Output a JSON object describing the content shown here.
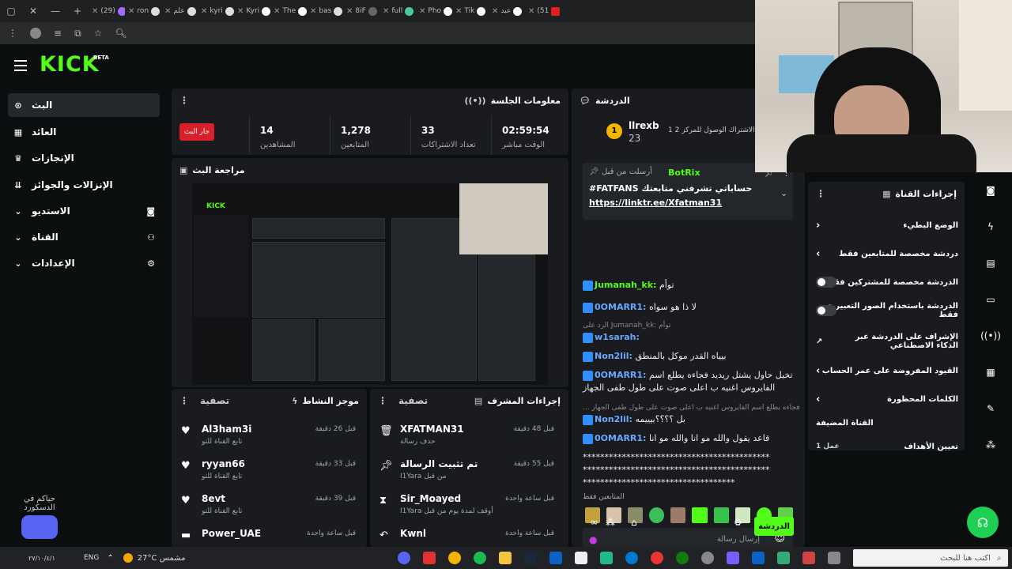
{
  "browser": {
    "tabs": [
      {
        "label": "(29)"
      },
      {
        "label": "ron"
      },
      {
        "label": "علم"
      },
      {
        "label": "kyri"
      },
      {
        "label": "Kyri"
      },
      {
        "label": "The"
      },
      {
        "label": "bas"
      },
      {
        "label": "8iF"
      },
      {
        "label": "full"
      },
      {
        "label": "Pho"
      },
      {
        "label": "Tik"
      },
      {
        "label": "عبد"
      },
      {
        "label": "(51"
      }
    ]
  },
  "kick": {
    "logo": "KICK",
    "beta": "BETA",
    "sidebar": {
      "items": [
        {
          "label": "البث",
          "active": true
        },
        {
          "label": "العائد"
        },
        {
          "label": "الإنجازات"
        },
        {
          "label": "الإنزالات والجوائز"
        },
        {
          "label": "الاستديو"
        },
        {
          "label": "القناة"
        },
        {
          "label": "الإعدادات"
        }
      ],
      "discord_text": "حياكم في الدسكورد"
    },
    "session": {
      "title": "معلومات الجلسة",
      "live_label": "جار البث",
      "stats": [
        {
          "value": "14",
          "label": "المشاهدين"
        },
        {
          "value": "1,278",
          "label": "المتابعين"
        },
        {
          "value": "33",
          "label": "تعداد الاشتراكات"
        },
        {
          "value": "02:59:54",
          "label": "الوقت مباشر"
        }
      ]
    },
    "preview": {
      "title": "مراجعة البث"
    },
    "activity": {
      "title": "موجز النشاط",
      "filter_label": "تصفية",
      "items": [
        {
          "name": "Al3ham3i",
          "sub": "تابع القناة للتو",
          "time": "قبل 26 دقيقة"
        },
        {
          "name": "ryyan66",
          "sub": "تابع القناة للتو",
          "time": "قبل 33 دقيقة"
        },
        {
          "name": "8evt",
          "sub": "تابع القناة للتو",
          "time": "قبل 39 دقيقة"
        },
        {
          "name": "Power_UAE",
          "sub": "",
          "time": "قبل ساعة واحدة"
        }
      ]
    },
    "modlog": {
      "title": "إجراءات المشرف",
      "filter_label": "تصفية",
      "items": [
        {
          "name": "XFATMAN31",
          "sub": "حذف رسالة",
          "time": "قبل 48 دقيقة",
          "icon": "trash-icon"
        },
        {
          "name": "تم تثبيت الرسالة",
          "sub": "I1Yara من قبل",
          "time": "قبل 55 دقيقة",
          "icon": "pin-icon"
        },
        {
          "name": "Sir_Moayed",
          "sub": "I1Yara أوقف لمدة يوم من قبل",
          "time": "قبل ساعة واحدة",
          "icon": "hourglass-icon"
        },
        {
          "name": "Kwnl",
          "sub": "",
          "time": "قبل ساعة واحدة",
          "icon": "undo-icon"
        }
      ]
    },
    "chat": {
      "title": "الدردشة",
      "top_gifter": {
        "name": "llrexb",
        "count": "23",
        "note": "1 الاشتراك الوصول للمركز 2"
      },
      "pinned": {
        "by_label": "أرسلت من قبل",
        "user": "BotRix",
        "text": "#FATFANS حساباتي تشرفني متابعتك",
        "link": "https://linktr.ee/Xfatman31"
      },
      "messages": [
        {
          "user": "Jumanah_kk:",
          "text": "توأم",
          "color": "#53fc18"
        },
        {
          "user": "0OMARR1:",
          "text": "لا ذا هو سواه",
          "color": "#6aa8ff"
        },
        {
          "user": "",
          "text": "الرد على Jumanah_kk: توأم",
          "color": "#888",
          "reply": true
        },
        {
          "user": "w1sarah:",
          "text": "",
          "color": "#6aa8ff"
        },
        {
          "user": "Non2lil:",
          "text": "بيياه القدر موكل بالمنطق",
          "color": "#6aa8ff"
        },
        {
          "user": "0OMARR1:",
          "text": "تخيل حاول يشتل ريديد فجاءه يطلع اسم",
          "color": "#6aa8ff"
        },
        {
          "user": "",
          "text": "الفايروس اغنيه ب اعلى صوت على طول طفى الجهاز",
          "color": "#eee"
        },
        {
          "user": "",
          "text": "... فجاءه يطلع اسم الفايروس اغنيه ب اعلى صوت على طول طفى الجهاز",
          "color": "#888",
          "reply": true
        },
        {
          "user": "Non2lil:",
          "text": "بل ؟؟؟؟بيييمه",
          "color": "#6aa8ff"
        },
        {
          "user": "0OMARR1:",
          "text": "قاعد يقول والله مو انا والله مو انا",
          "color": "#6aa8ff"
        },
        {
          "user": "",
          "text": "*******************************************",
          "color": "#eee"
        },
        {
          "user": "",
          "text": "*******************************************",
          "color": "#eee"
        },
        {
          "user": "",
          "text": "***********************************",
          "color": "#eee"
        }
      ],
      "followers_only_label": "المتابعين فقط",
      "input_placeholder": "إرسال رسالة",
      "send_label": "الدردشة"
    },
    "channel_actions": {
      "title": "إجراءات القناة",
      "items": [
        {
          "label": "الوضع البطيء",
          "type": "chevron"
        },
        {
          "label": "دردشة مخصصة للمتابعين فقط",
          "type": "chevron"
        },
        {
          "label": "الدردشة مخصصة للمشتركين فقط",
          "type": "toggle"
        },
        {
          "label": "الدردشة باستخدام الصور التعبيرية فقط",
          "type": "toggle"
        },
        {
          "label": "الإشراف على الدردشة عبر الذكاء الاصطناعي",
          "type": "external"
        },
        {
          "label": "القيود المفروضة على عمر الحساب",
          "type": "chevron"
        },
        {
          "label": "الكلمات المحظورة",
          "type": "chevron"
        },
        {
          "label": "القناة المضيفة",
          "type": "none"
        },
        {
          "label": "تعيين الأهداف",
          "type": "chevron",
          "extra": "عمل 1"
        }
      ]
    }
  },
  "taskbar": {
    "lang": "ENG",
    "date": "٢٧/١٠/٤/١",
    "weather": "27°C مشمس",
    "search_placeholder": "اكتب هنا للبحث"
  },
  "colors": {
    "accent": "#53fc18",
    "panel": "#191b1f",
    "bg": "#0b0e0f",
    "live": "#d8202a"
  }
}
